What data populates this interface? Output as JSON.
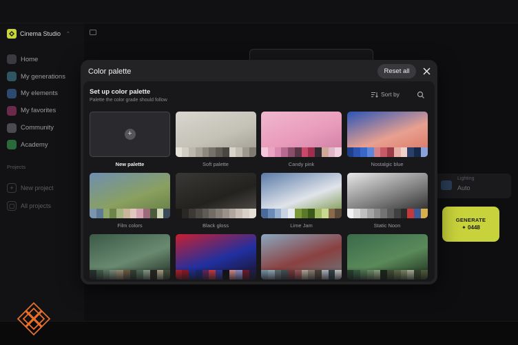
{
  "app": {
    "name": "Cinema Studio",
    "nav": [
      {
        "label": "Home",
        "color": "#3a3a40"
      },
      {
        "label": "My generations",
        "color": "#2f5560"
      },
      {
        "label": "My elements",
        "color": "#2c4a70"
      },
      {
        "label": "My favorites",
        "color": "#6a2a4a"
      },
      {
        "label": "Community",
        "color": "#4a4a50"
      },
      {
        "label": "Academy",
        "color": "#2a6a3a"
      }
    ],
    "projects_label": "Projects",
    "projects": [
      {
        "label": "New project",
        "icon": "+"
      },
      {
        "label": "All projects",
        "icon": "▢"
      }
    ],
    "accent": "#c8d23a"
  },
  "right_panel": {
    "lighting_label": "Lighting",
    "lighting_value": "Auto",
    "generate_label": "GENERATE",
    "generate_credits": "✦ 0448"
  },
  "modal": {
    "title": "Color palette",
    "reset_label": "Reset all",
    "subtitle": "Set up color palette",
    "description": "Palette the color grade should follow",
    "sort_label": "Sort by",
    "new_palette_label": "New palette",
    "palettes": [
      {
        "name": "Soft palette",
        "scene": [
          "#d9d7cf",
          "#c4c1b6",
          "#9a978c"
        ],
        "swatches": [
          "#e6e3da",
          "#d2cec4",
          "#bdb8ad",
          "#a8a398",
          "#8f8a80",
          "#76726a",
          "#5f5b55",
          "#4a4743",
          "#d8d4ca",
          "#c2bdb3",
          "#9e998f",
          "#7f7a72"
        ]
      },
      {
        "name": "Candy pink",
        "scene": [
          "#f0b7cf",
          "#e89ab9",
          "#c97aa0"
        ],
        "swatches": [
          "#f6c7da",
          "#eaa3c3",
          "#d98aae",
          "#b66a8f",
          "#8a4e6a",
          "#5a3546",
          "#c74a6a",
          "#9e2e4c",
          "#2f2a30",
          "#cfa89a",
          "#e0b7c8",
          "#f2d2df"
        ]
      },
      {
        "name": "Nostalgic blue",
        "scene": [
          "#2a55b8",
          "#e8a090",
          "#d97060"
        ],
        "swatches": [
          "#1f3f8c",
          "#2c54b0",
          "#3a68c8",
          "#5f86d8",
          "#d6808a",
          "#c65a66",
          "#9a3c48",
          "#e6b0a8",
          "#f0d0c8",
          "#2a3f6a",
          "#18284a",
          "#8aa2d8"
        ]
      },
      {
        "name": "Film colors",
        "scene": [
          "#6e8fb0",
          "#8aa060",
          "#5f7840"
        ],
        "swatches": [
          "#7a95b0",
          "#5e7a95",
          "#8fa66a",
          "#6d8548",
          "#a5b480",
          "#c9b69a",
          "#e0c8c0",
          "#d6a3b2",
          "#9c6a7a",
          "#4a5a3a",
          "#cfd7b8",
          "#3a4a5a"
        ]
      },
      {
        "name": "Black gloss",
        "scene": [
          "#3a3836",
          "#24221f",
          "#5a5652"
        ],
        "swatches": [
          "#1a1918",
          "#2a2826",
          "#3b3835",
          "#4d4945",
          "#5f5a55",
          "#726c66",
          "#857e77",
          "#9a928a",
          "#b0a79e",
          "#c7bdb3",
          "#d8d0c6",
          "#e6e0d8"
        ]
      },
      {
        "name": "Lime Jam",
        "scene": [
          "#5a7aa8",
          "#e0e4ea",
          "#6a8a30"
        ],
        "swatches": [
          "#4a6a9a",
          "#6a8ab8",
          "#9ab0d0",
          "#c8d4e4",
          "#e8ecf0",
          "#7a9a3a",
          "#5a7a28",
          "#3a5a1a",
          "#a0b860",
          "#c8d890",
          "#8a6a4a",
          "#5a4a3a"
        ]
      },
      {
        "name": "Static Noon",
        "scene": [
          "#e8e8e8",
          "#7a7a7a",
          "#1a1a1a"
        ],
        "swatches": [
          "#f2f2f2",
          "#d8d8d8",
          "#bfbfbf",
          "#a5a5a5",
          "#8c8c8c",
          "#737373",
          "#5a5a5a",
          "#404040",
          "#2a2a2a",
          "#c43a3a",
          "#3a5a9a",
          "#d8b04a"
        ]
      },
      {
        "name": "",
        "scene": [
          "#3a5a48",
          "#6a8a70",
          "#1e2a22"
        ],
        "swatches": [
          "#2a3a30",
          "#4a6a52",
          "#6a8a70",
          "#8aa08a",
          "#b0a080",
          "#7a6a4a",
          "#3a4a3a",
          "#5a7a60",
          "#9ab09a",
          "#2a2a20",
          "#c0b898",
          "#4a5a40"
        ]
      },
      {
        "name": "",
        "scene": [
          "#c82030",
          "#2030a0",
          "#1a1020"
        ],
        "swatches": [
          "#c82030",
          "#a01828",
          "#2030a0",
          "#1a2a80",
          "#6a2a6a",
          "#e04050",
          "#3a3ab0",
          "#101018",
          "#f0a0a0",
          "#a0a0e0",
          "#7a1a30",
          "#202050"
        ]
      },
      {
        "name": "",
        "scene": [
          "#8aa8c0",
          "#8a4040",
          "#6a7a80"
        ],
        "swatches": [
          "#8aa8c0",
          "#a8c0d0",
          "#6a7a80",
          "#4a5a60",
          "#8a4040",
          "#b06060",
          "#d0c0b0",
          "#a09080",
          "#5a4a40",
          "#c8d0d8",
          "#3a4a50",
          "#e0e0e0"
        ]
      },
      {
        "name": "",
        "scene": [
          "#3a6a4a",
          "#5a8a5a",
          "#1a2a1a"
        ],
        "swatches": [
          "#2a4a30",
          "#3a6a4a",
          "#5a8a5a",
          "#7aa070",
          "#a0b890",
          "#1a2a1a",
          "#4a5a3a",
          "#6a7a50",
          "#8a9a70",
          "#c0c8a8",
          "#3a4a30",
          "#5a6a40"
        ]
      }
    ]
  }
}
